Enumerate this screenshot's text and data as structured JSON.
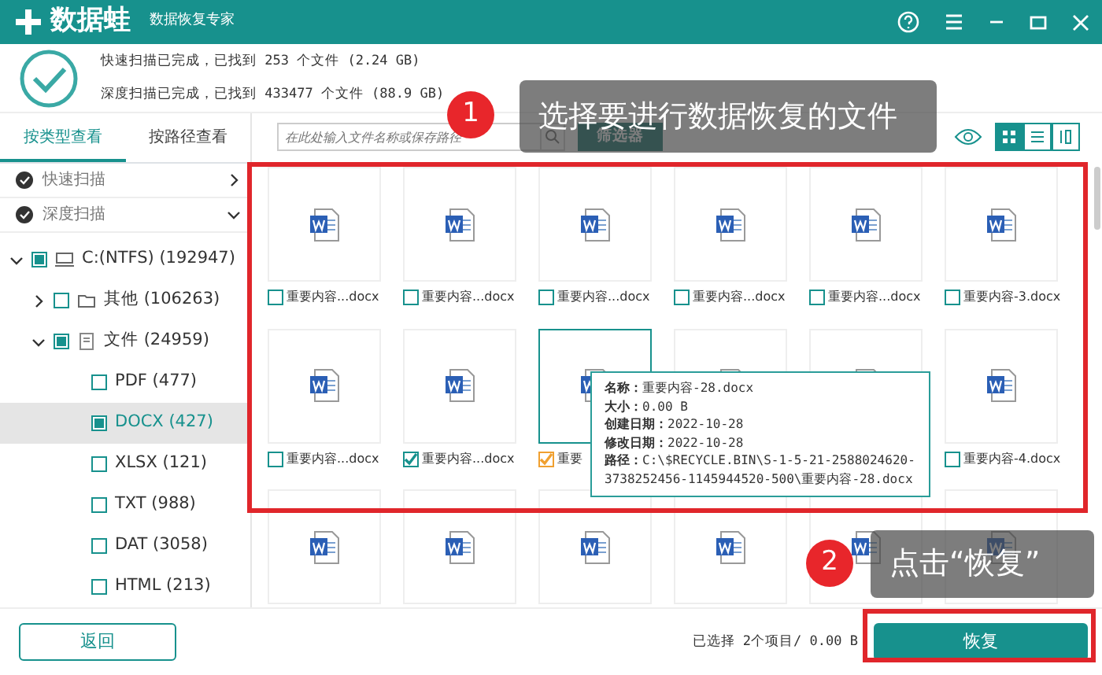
{
  "app": {
    "logo": "数据蛙",
    "subtitle": "数据恢复专家"
  },
  "scan_summary": [
    "快速扫描已完成，已找到 253 个文件 (2.24 GB)",
    "深度扫描已完成，已找到 433477 个文件 (88.9 GB)"
  ],
  "sidebar": {
    "tabs": [
      {
        "label": "按类型查看",
        "selected": true
      },
      {
        "label": "按路径查看",
        "selected": false
      }
    ],
    "scan_modes": [
      {
        "label": "快速扫描",
        "expanded": false
      },
      {
        "label": "深度扫描",
        "expanded": true
      }
    ],
    "tree": [
      {
        "label": "C:(NTFS) (192947)",
        "kind": "drive",
        "checked": true,
        "expanded": true,
        "selected": false,
        "children": [
          {
            "label": "其他 (106263)",
            "kind": "folder",
            "checked": false,
            "expanded": false,
            "selected": false
          },
          {
            "label": "文件 (24959)",
            "kind": "category",
            "checked": true,
            "expanded": true,
            "selected": false,
            "children": [
              {
                "label": "PDF (477)",
                "checked": false,
                "selected": false
              },
              {
                "label": "DOCX (427)",
                "checked": true,
                "selected": true
              },
              {
                "label": "XLSX (121)",
                "checked": false,
                "selected": false
              },
              {
                "label": "TXT (988)",
                "checked": false,
                "selected": false
              },
              {
                "label": "DAT (3058)",
                "checked": false,
                "selected": false
              },
              {
                "label": "HTML (213)",
                "checked": false,
                "selected": false
              }
            ]
          }
        ]
      }
    ],
    "back_button": "返回"
  },
  "toolbar": {
    "search": {
      "placeholder": "在此处输入文件名称或保存路径"
    },
    "filter_button": "筛选器",
    "views": [
      {
        "kind": "grid",
        "selected": true
      },
      {
        "kind": "list",
        "selected": false
      },
      {
        "kind": "detail",
        "selected": false
      }
    ]
  },
  "files": [
    {
      "label": "重要内容...docx",
      "checked": false,
      "selected": false
    },
    {
      "label": "重要内容...docx",
      "checked": false,
      "selected": false
    },
    {
      "label": "重要内容...docx",
      "checked": false,
      "selected": false
    },
    {
      "label": "重要内容...docx",
      "checked": false,
      "selected": false
    },
    {
      "label": "重要内容...docx",
      "checked": false,
      "selected": false
    },
    {
      "label": "重要内容-3.docx",
      "checked": false,
      "selected": false
    },
    {
      "label": "重要内容...docx",
      "checked": false,
      "selected": false
    },
    {
      "label": "重要内容...docx",
      "checked": true,
      "selected": false
    },
    {
      "label": "重要",
      "checked": true,
      "selected": true
    },
    {
      "selected": false
    },
    {
      "selected": false
    },
    {
      "label": "重要内容-4.docx",
      "checked": false,
      "selected": false
    },
    {
      "selected": false
    },
    {
      "selected": false
    },
    {
      "selected": false
    },
    {
      "selected": false
    },
    {
      "selected": false
    },
    {
      "selected": false
    }
  ],
  "file_tooltip": [
    {
      "key": "名称：",
      "value": "重要内容-28.docx"
    },
    {
      "key": "大小：",
      "value": "0.00 B"
    },
    {
      "key": "创建日期：",
      "value": "2022-10-28"
    },
    {
      "key": "修改日期：",
      "value": "2022-10-28"
    },
    {
      "key": "路径：",
      "value": "C:\\$RECYCLE.BIN\\S-1-5-21-2588024620-3738252456-1145944520-500\\重要内容-28.docx"
    }
  ],
  "status": "已选择 2个项目/ 0.00 B",
  "recover_button": "恢复",
  "callouts": [
    {
      "number": "1",
      "text": "选择要进行数据恢复的文件"
    },
    {
      "number": "2",
      "text": "点击“恢复”"
    }
  ]
}
